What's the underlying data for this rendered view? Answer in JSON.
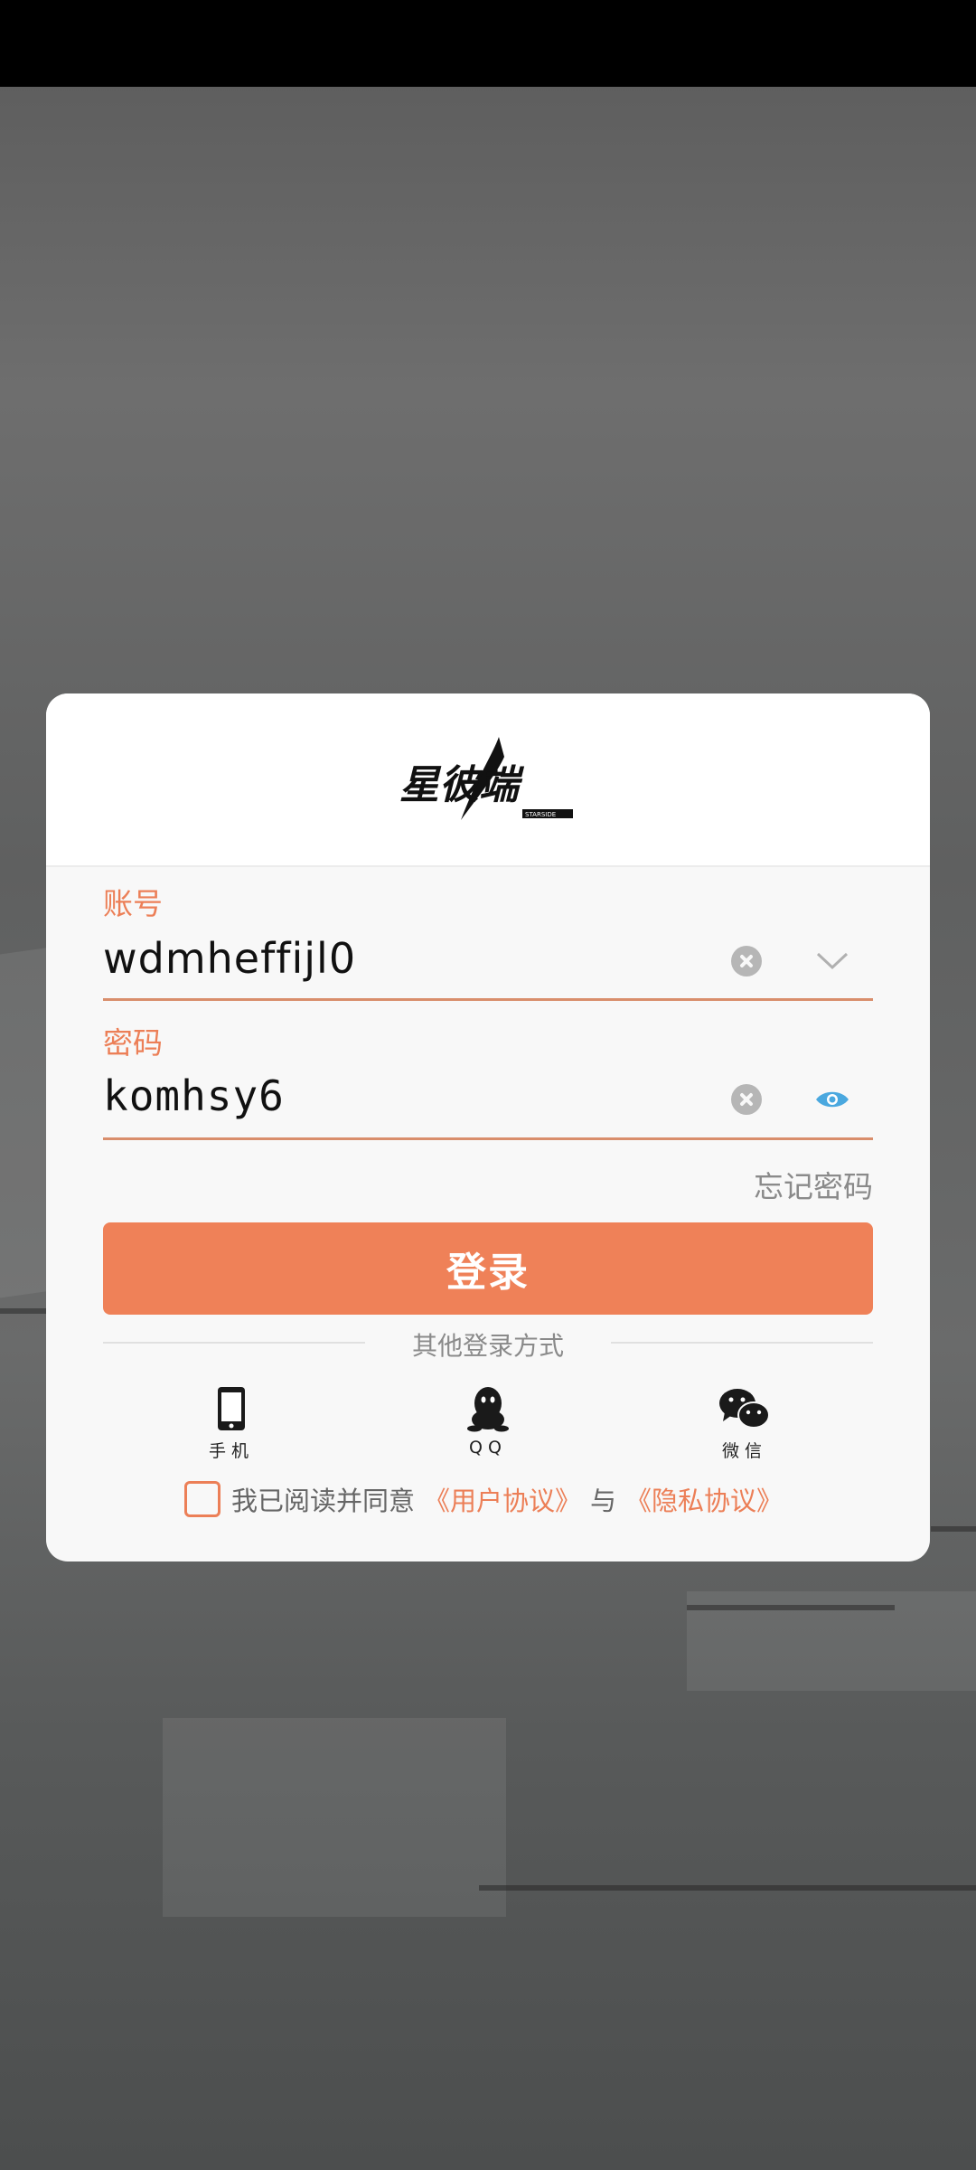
{
  "app": {
    "logo_text": "星彼端",
    "logo_sub": "STARSIDE"
  },
  "login_form": {
    "account": {
      "label": "账号",
      "value": "wdmheffijl0"
    },
    "password": {
      "label": "密码",
      "value": "komhsy6"
    },
    "forgot_password": "忘记密码",
    "login_button": "登录",
    "other_methods_label": "其他登录方式",
    "methods": [
      {
        "label": "手机",
        "icon": "phone-icon"
      },
      {
        "label": "QQ",
        "icon": "qq-icon"
      },
      {
        "label": "微信",
        "icon": "wechat-icon"
      }
    ],
    "agreement": {
      "prefix": "我已阅读并同意",
      "user_agreement": "《用户协议》",
      "and": "与",
      "privacy_agreement": "《隐私协议》",
      "checked": false
    }
  },
  "colors": {
    "accent": "#ef8158",
    "label": "#ec7f57",
    "muted": "#8a8a8a",
    "eye": "#4aa8df"
  }
}
